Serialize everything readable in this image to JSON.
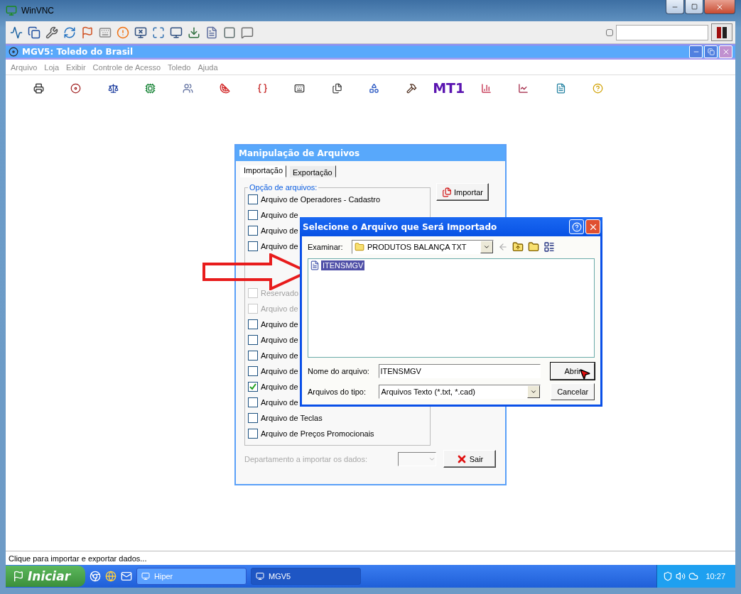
{
  "vnc_window": {
    "title": "WinVNC"
  },
  "app_window": {
    "title": "MGV5: Toledo do Brasil",
    "menu": [
      "Arquivo",
      "Loja",
      "Exibir",
      "Controle de Acesso",
      "Toledo",
      "Ajuda"
    ],
    "toolbar": [
      {
        "kind": "icon"
      },
      {
        "kind": "icon"
      },
      {
        "kind": "icon"
      },
      {
        "kind": "icon"
      },
      {
        "kind": "icon"
      },
      {
        "kind": "icon"
      },
      {
        "kind": "icon"
      },
      {
        "kind": "icon"
      },
      {
        "kind": "icon"
      },
      {
        "kind": "icon"
      },
      {
        "kind": "icon"
      },
      {
        "kind": "text",
        "label": "MT1"
      },
      {
        "kind": "icon"
      },
      {
        "kind": "icon"
      },
      {
        "kind": "icon"
      },
      {
        "kind": "icon"
      }
    ],
    "status_bar": "Clique para importar e exportar dados..."
  },
  "import_dialog": {
    "title": "Manipulação de Arquivos",
    "tabs": [
      {
        "label": "Importação",
        "selected": true
      },
      {
        "label": "Exportação",
        "selected": false
      }
    ],
    "group_label": "Opção de arquivos:",
    "options_top": [
      {
        "label": "Arquivo de Operadores - Cadastro",
        "checked": false,
        "disabled": false
      },
      {
        "label": "Arquivo de",
        "checked": false,
        "disabled": false
      },
      {
        "label": "Arquivo de",
        "checked": false,
        "disabled": false
      },
      {
        "label": "Arquivo de",
        "checked": false,
        "disabled": false
      }
    ],
    "options_bottom": [
      {
        "label": "Reservado",
        "checked": false,
        "disabled": true
      },
      {
        "label": "Arquivo de",
        "checked": false,
        "disabled": true
      },
      {
        "label": "Arquivo de",
        "checked": false,
        "disabled": false
      },
      {
        "label": "Arquivo de",
        "checked": false,
        "disabled": false
      },
      {
        "label": "Arquivo de",
        "checked": false,
        "disabled": false
      },
      {
        "label": "Arquivo de",
        "checked": false,
        "disabled": false
      },
      {
        "label": "Arquivo de",
        "checked": true,
        "disabled": false
      },
      {
        "label": "Arquivo de",
        "checked": false,
        "disabled": false
      },
      {
        "label": "Arquivo de Teclas",
        "checked": false,
        "disabled": false
      },
      {
        "label": "Arquivo de Preços Promocionais",
        "checked": false,
        "disabled": false
      }
    ],
    "import_button": "Importar",
    "department_label": "Departamento a importar os dados:",
    "exit_button": "Sair"
  },
  "file_dialog": {
    "title": "Selecione o Arquivo que Será Importado",
    "look_in_label": "Examinar:",
    "folder": "PRODUTOS BALANÇA TXT",
    "files": [
      {
        "name": "ITENSMGV",
        "selected": true
      }
    ],
    "file_name_label": "Nome do arquivo:",
    "file_name": "ITENSMGV",
    "file_type_label": "Arquivos do tipo:",
    "file_type": "Arquivos Texto (*.txt, *.cad)",
    "open_button": "Abrir",
    "cancel_button": "Cancelar"
  },
  "taskbar": {
    "start": "Iniciar",
    "tasks": [
      {
        "label": "Hiper",
        "selected": true
      },
      {
        "label": "MGV5",
        "selected": false
      }
    ],
    "clock": "10:27"
  }
}
